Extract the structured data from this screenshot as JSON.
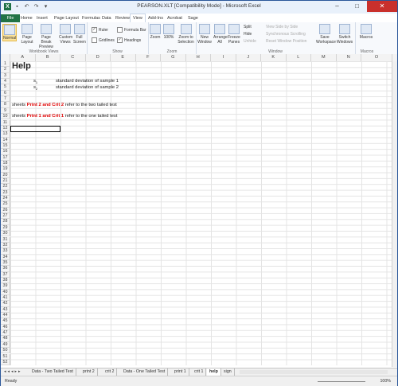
{
  "window": {
    "title": "PEARSON.XLT  [Compatibility Mode]  -  Microsoft Excel",
    "app_icon": "X",
    "minimize": "–",
    "maximize": "□",
    "close": "✕"
  },
  "ribbon_tabs": [
    "File",
    "Home",
    "Insert",
    "Page Layout",
    "Formulas",
    "Data",
    "Review",
    "View",
    "Add-Ins",
    "Acrobat",
    "Sage"
  ],
  "active_tab": "View",
  "ribbon": {
    "workbook_views": {
      "label": "Workbook Views",
      "normal": "Normal",
      "page_layout": "Page Layout",
      "page_break_preview": "Page Break Preview",
      "custom_views": "Custom Views",
      "full_screen": "Full Screen"
    },
    "show": {
      "label": "Show",
      "ruler": "Ruler",
      "formula_bar": "Formula Bar",
      "gridlines": "Gridlines",
      "headings": "Headings",
      "ruler_checked": true,
      "formula_bar_checked": false,
      "gridlines_checked": false,
      "headings_checked": true
    },
    "zoom": {
      "label": "Zoom",
      "zoom": "Zoom",
      "hundred": "100%",
      "zoom_to_selection": "Zoom to Selection"
    },
    "window": {
      "label": "Window",
      "new_window": "New Window",
      "arrange_all": "Arrange All",
      "freeze_panes": "Freeze Panes",
      "split": "Split",
      "hide": "Hide",
      "unhide": "Unhide",
      "view_side_by_side": "View Side by Side",
      "sync_scrolling": "Synchronous Scrolling",
      "reset_window_position": "Reset Window Position",
      "save_workspace": "Save Workspace",
      "switch_windows": "Switch Windows"
    },
    "macros": {
      "label": "Macros",
      "macros": "Macros"
    }
  },
  "columns": [
    "A",
    "B",
    "C",
    "D",
    "E",
    "F",
    "G",
    "H",
    "I",
    "J",
    "K",
    "L",
    "M",
    "N",
    "O"
  ],
  "rows": [
    "1",
    "2",
    "3",
    "4",
    "5",
    "6",
    "7",
    "8",
    "9",
    "10",
    "11",
    "12",
    "13",
    "14",
    "15",
    "16",
    "17",
    "18",
    "19",
    "20",
    "21",
    "22",
    "23",
    "24",
    "25",
    "26",
    "27",
    "28",
    "29",
    "30",
    "31",
    "32",
    "33",
    "34",
    "35",
    "36",
    "37",
    "38",
    "39",
    "40",
    "41",
    "42",
    "43",
    "44",
    "45",
    "46",
    "47",
    "48",
    "49",
    "50",
    "51",
    "52"
  ],
  "cells": {
    "a1": "Help",
    "s1_symbol": "s",
    "s1_sub": "1",
    "s1_text": "standard deviation of sample 1",
    "s2_symbol": "s",
    "s2_sub": "2",
    "s2_text": "standard deviation of sample 2",
    "row8_prefix": "sheets ",
    "row8_red": "Print 2 and Crit 2",
    "row8_suffix": " refer to the two tailed test",
    "row10_prefix": "sheets ",
    "row10_red": "Print 1 and Crit 1",
    "row10_suffix": " refer to the one tailed test"
  },
  "sheet_tabs": [
    "Data - Two Tailed Test",
    "print 2",
    "crit 2",
    "Data - One Tailed Test",
    "print 1",
    "crit 1",
    "help",
    "sign"
  ],
  "active_sheet": "help",
  "status": {
    "ready": "Ready",
    "zoom": "100%"
  },
  "colors": {
    "file_tab": "#217346",
    "red_text": "#e00000",
    "close_button": "#c9302c"
  }
}
